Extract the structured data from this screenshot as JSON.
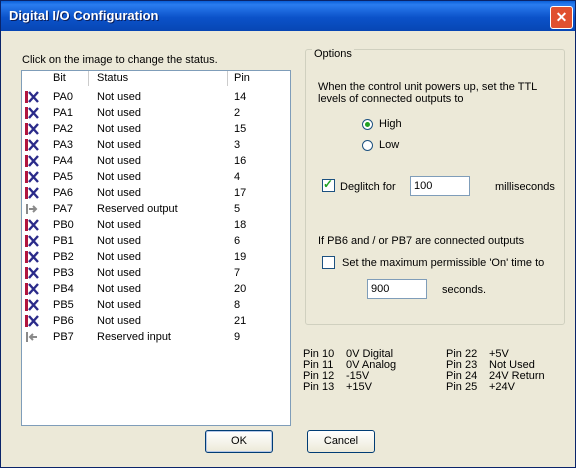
{
  "window": {
    "title": "Digital I/O Configuration",
    "close_glyph": "✕"
  },
  "instruction": "Click on the image to change the status.",
  "table": {
    "columns": [
      "Bit",
      "Status",
      "Pin"
    ],
    "rows": [
      {
        "icon": "x-icon",
        "bit": "PA0",
        "status": "Not used",
        "pin": "14"
      },
      {
        "icon": "x-icon",
        "bit": "PA1",
        "status": "Not used",
        "pin": "2"
      },
      {
        "icon": "x-icon",
        "bit": "PA2",
        "status": "Not used",
        "pin": "15"
      },
      {
        "icon": "x-icon",
        "bit": "PA3",
        "status": "Not used",
        "pin": "3"
      },
      {
        "icon": "x-icon",
        "bit": "PA4",
        "status": "Not used",
        "pin": "16"
      },
      {
        "icon": "x-icon",
        "bit": "PA5",
        "status": "Not used",
        "pin": "4"
      },
      {
        "icon": "x-icon",
        "bit": "PA6",
        "status": "Not used",
        "pin": "17"
      },
      {
        "icon": "output-arrow-icon",
        "bit": "PA7",
        "status": "Reserved output",
        "pin": "5"
      },
      {
        "icon": "x-icon",
        "bit": "PB0",
        "status": "Not used",
        "pin": "18"
      },
      {
        "icon": "x-icon",
        "bit": "PB1",
        "status": "Not used",
        "pin": "6"
      },
      {
        "icon": "x-icon",
        "bit": "PB2",
        "status": "Not used",
        "pin": "19"
      },
      {
        "icon": "x-icon",
        "bit": "PB3",
        "status": "Not used",
        "pin": "7"
      },
      {
        "icon": "x-icon",
        "bit": "PB4",
        "status": "Not used",
        "pin": "20"
      },
      {
        "icon": "x-icon",
        "bit": "PB5",
        "status": "Not used",
        "pin": "8"
      },
      {
        "icon": "x-icon",
        "bit": "PB6",
        "status": "Not used",
        "pin": "21"
      },
      {
        "icon": "input-arrow-icon",
        "bit": "PB7",
        "status": "Reserved input",
        "pin": "9"
      }
    ]
  },
  "options": {
    "legend": "Options",
    "powerup_text_1": "When the control unit powers up, set the TTL",
    "powerup_text_2": "levels of connected outputs to",
    "radio_high": "High",
    "radio_low": "Low",
    "radio_selected": "High",
    "deglitch_label": "Deglitch for",
    "deglitch_checked": true,
    "deglitch_value": "100",
    "deglitch_unit": "milliseconds",
    "pb_text": "If PB6 and / or PB7 are connected outputs",
    "max_on_label": "Set the maximum permissible 'On' time to",
    "max_on_checked": false,
    "max_on_value": "900",
    "max_on_unit": "seconds."
  },
  "pins": {
    "left": [
      {
        "pin": "Pin 10",
        "desc": "0V Digital"
      },
      {
        "pin": "Pin 11",
        "desc": "0V Analog"
      },
      {
        "pin": "Pin 12",
        "desc": "-15V"
      },
      {
        "pin": "Pin 13",
        "desc": "+15V"
      }
    ],
    "right": [
      {
        "pin": "Pin 22",
        "desc": "+5V"
      },
      {
        "pin": "Pin 23",
        "desc": "Not Used"
      },
      {
        "pin": "Pin 24",
        "desc": "24V Return"
      },
      {
        "pin": "Pin 25",
        "desc": "+24V"
      }
    ]
  },
  "buttons": {
    "ok": "OK",
    "cancel": "Cancel"
  },
  "colors": {
    "x_icon": "#b0163f",
    "arrow_icon": "#8a8a8a",
    "title_bar": "#0b52c9"
  }
}
